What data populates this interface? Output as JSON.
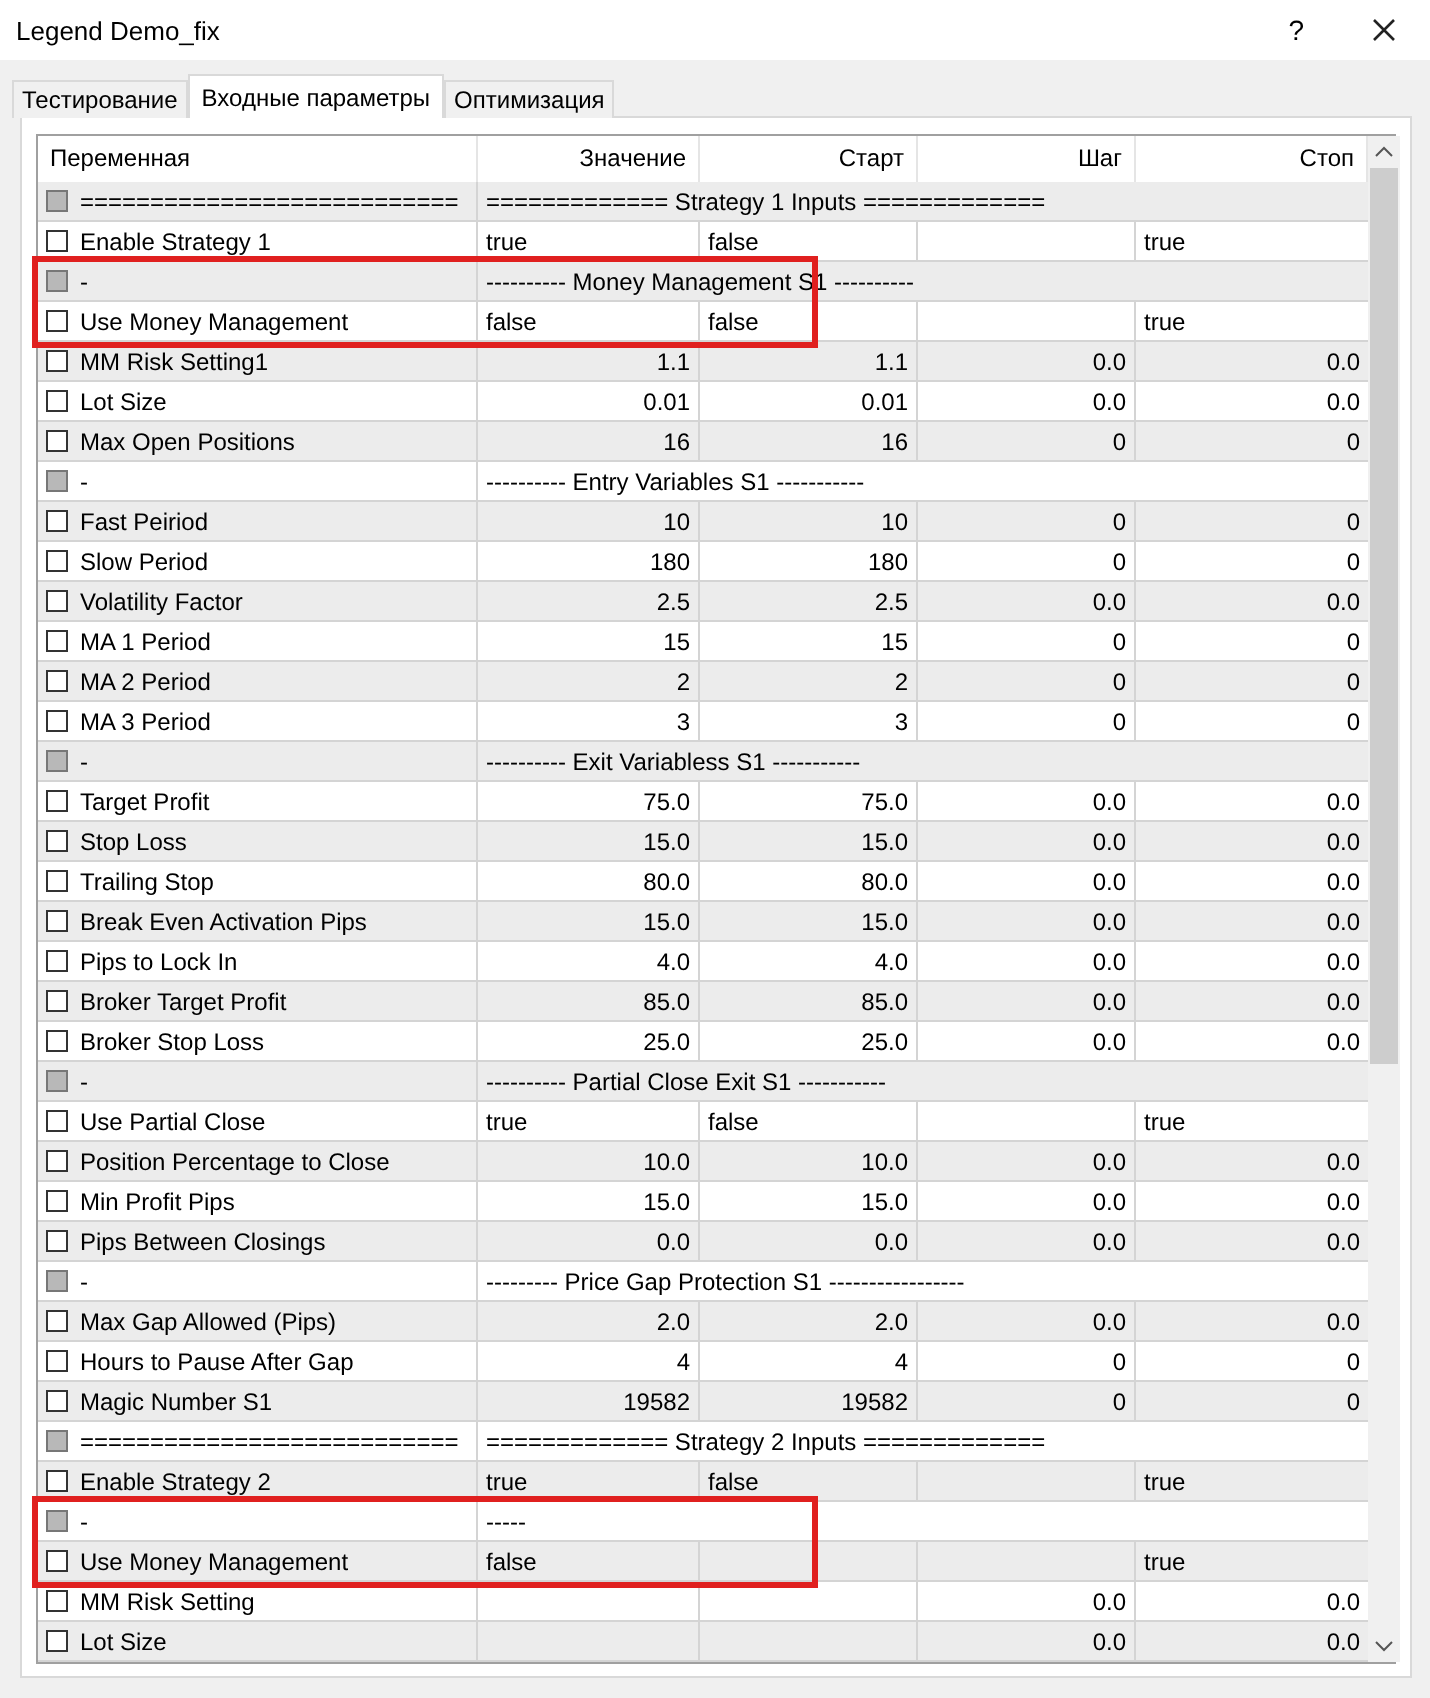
{
  "window": {
    "title": "Legend Demo_fix",
    "help": "?"
  },
  "tabs": [
    {
      "label": "Тестирование",
      "selected": false
    },
    {
      "label": "Входные параметры",
      "selected": true
    },
    {
      "label": "Оптимизация",
      "selected": false
    }
  ],
  "table": {
    "columns": [
      "Переменная",
      "Значение",
      "Старт",
      "Шаг",
      "Стоп"
    ],
    "rows": [
      {
        "kind": "separator",
        "name": "===========================",
        "value": "============= Strategy 1 Inputs =============",
        "checked": false,
        "highlighted": false
      },
      {
        "kind": "bool",
        "name": "Enable Strategy 1",
        "value": "true",
        "start": "false",
        "step": "",
        "stop": "true",
        "checked": false,
        "highlighted": false
      },
      {
        "kind": "separator",
        "name": "-",
        "value": "---------- Money Management S1 ----------",
        "checked": false,
        "highlighted": true
      },
      {
        "kind": "bool",
        "name": "Use Money Management",
        "value": "false",
        "start": "false",
        "step": "",
        "stop": "true",
        "checked": false,
        "highlighted": true
      },
      {
        "kind": "number",
        "name": "MM Risk Setting1",
        "value": "1.1",
        "start": "1.1",
        "step": "0.0",
        "stop": "0.0",
        "checked": false,
        "highlighted": false
      },
      {
        "kind": "number",
        "name": "Lot Size",
        "value": "0.01",
        "start": "0.01",
        "step": "0.0",
        "stop": "0.0",
        "checked": false,
        "highlighted": false
      },
      {
        "kind": "number",
        "name": "Max Open Positions",
        "value": "16",
        "start": "16",
        "step": "0",
        "stop": "0",
        "checked": false,
        "highlighted": false
      },
      {
        "kind": "separator",
        "name": "-",
        "value": "---------- Entry Variables S1 -----------",
        "checked": false,
        "highlighted": false
      },
      {
        "kind": "number",
        "name": "Fast Peiriod",
        "value": "10",
        "start": "10",
        "step": "0",
        "stop": "0",
        "checked": false,
        "highlighted": false
      },
      {
        "kind": "number",
        "name": "Slow Period",
        "value": "180",
        "start": "180",
        "step": "0",
        "stop": "0",
        "checked": false,
        "highlighted": false
      },
      {
        "kind": "number",
        "name": "Volatility Factor",
        "value": "2.5",
        "start": "2.5",
        "step": "0.0",
        "stop": "0.0",
        "checked": false,
        "highlighted": false
      },
      {
        "kind": "number",
        "name": "MA 1 Period",
        "value": "15",
        "start": "15",
        "step": "0",
        "stop": "0",
        "checked": false,
        "highlighted": false
      },
      {
        "kind": "number",
        "name": "MA 2 Period",
        "value": "2",
        "start": "2",
        "step": "0",
        "stop": "0",
        "checked": false,
        "highlighted": false
      },
      {
        "kind": "number",
        "name": "MA 3 Period",
        "value": "3",
        "start": "3",
        "step": "0",
        "stop": "0",
        "checked": false,
        "highlighted": false
      },
      {
        "kind": "separator",
        "name": "-",
        "value": "---------- Exit Variabless S1 -----------",
        "checked": false,
        "highlighted": false
      },
      {
        "kind": "number",
        "name": "Target Profit",
        "value": "75.0",
        "start": "75.0",
        "step": "0.0",
        "stop": "0.0",
        "checked": false,
        "highlighted": false
      },
      {
        "kind": "number",
        "name": "Stop Loss",
        "value": "15.0",
        "start": "15.0",
        "step": "0.0",
        "stop": "0.0",
        "checked": false,
        "highlighted": false
      },
      {
        "kind": "number",
        "name": "Trailing Stop",
        "value": "80.0",
        "start": "80.0",
        "step": "0.0",
        "stop": "0.0",
        "checked": false,
        "highlighted": false
      },
      {
        "kind": "number",
        "name": "Break Even Activation Pips",
        "value": "15.0",
        "start": "15.0",
        "step": "0.0",
        "stop": "0.0",
        "checked": false,
        "highlighted": false
      },
      {
        "kind": "number",
        "name": "Pips to Lock In",
        "value": "4.0",
        "start": "4.0",
        "step": "0.0",
        "stop": "0.0",
        "checked": false,
        "highlighted": false
      },
      {
        "kind": "number",
        "name": "Broker Target Profit",
        "value": "85.0",
        "start": "85.0",
        "step": "0.0",
        "stop": "0.0",
        "checked": false,
        "highlighted": false
      },
      {
        "kind": "number",
        "name": "Broker Stop Loss",
        "value": "25.0",
        "start": "25.0",
        "step": "0.0",
        "stop": "0.0",
        "checked": false,
        "highlighted": false
      },
      {
        "kind": "separator",
        "name": "-",
        "value": "---------- Partial Close Exit S1 -----------",
        "checked": false,
        "highlighted": false
      },
      {
        "kind": "bool",
        "name": "Use Partial Close",
        "value": "true",
        "start": "false",
        "step": "",
        "stop": "true",
        "checked": false,
        "highlighted": false
      },
      {
        "kind": "number",
        "name": "Position Percentage to Close",
        "value": "10.0",
        "start": "10.0",
        "step": "0.0",
        "stop": "0.0",
        "checked": false,
        "highlighted": false
      },
      {
        "kind": "number",
        "name": "Min Profit Pips",
        "value": "15.0",
        "start": "15.0",
        "step": "0.0",
        "stop": "0.0",
        "checked": false,
        "highlighted": false
      },
      {
        "kind": "number",
        "name": "Pips Between Closings",
        "value": "0.0",
        "start": "0.0",
        "step": "0.0",
        "stop": "0.0",
        "checked": false,
        "highlighted": false
      },
      {
        "kind": "separator",
        "name": "-",
        "value": "--------- Price Gap Protection S1 -----------------",
        "checked": false,
        "highlighted": false
      },
      {
        "kind": "number",
        "name": "Max Gap Allowed (Pips)",
        "value": "2.0",
        "start": "2.0",
        "step": "0.0",
        "stop": "0.0",
        "checked": false,
        "highlighted": false
      },
      {
        "kind": "number",
        "name": "Hours to Pause After Gap",
        "value": "4",
        "start": "4",
        "step": "0",
        "stop": "0",
        "checked": false,
        "highlighted": false
      },
      {
        "kind": "number",
        "name": "Magic Number S1",
        "value": "19582",
        "start": "19582",
        "step": "0",
        "stop": "0",
        "checked": false,
        "highlighted": false
      },
      {
        "kind": "separator",
        "name": "===========================",
        "value": "============= Strategy 2 Inputs =============",
        "checked": false,
        "highlighted": false
      },
      {
        "kind": "bool",
        "name": "Enable Strategy 2",
        "value": "true",
        "start": "false",
        "step": "",
        "stop": "true",
        "checked": false,
        "highlighted": false
      },
      {
        "kind": "separator",
        "name": "-",
        "value": "-----",
        "checked": false,
        "highlighted": true
      },
      {
        "kind": "bool",
        "name": "Use Money Management",
        "value": "false",
        "start": "",
        "step": "",
        "stop": "true",
        "checked": false,
        "highlighted": true
      },
      {
        "kind": "number",
        "name": "MM Risk Setting",
        "value": "",
        "start": "",
        "step": "0.0",
        "stop": "0.0",
        "checked": false,
        "highlighted": false
      },
      {
        "kind": "number",
        "name": "Lot Size",
        "value": "",
        "start": "",
        "step": "0.0",
        "stop": "0.0",
        "checked": false,
        "highlighted": false
      }
    ]
  }
}
